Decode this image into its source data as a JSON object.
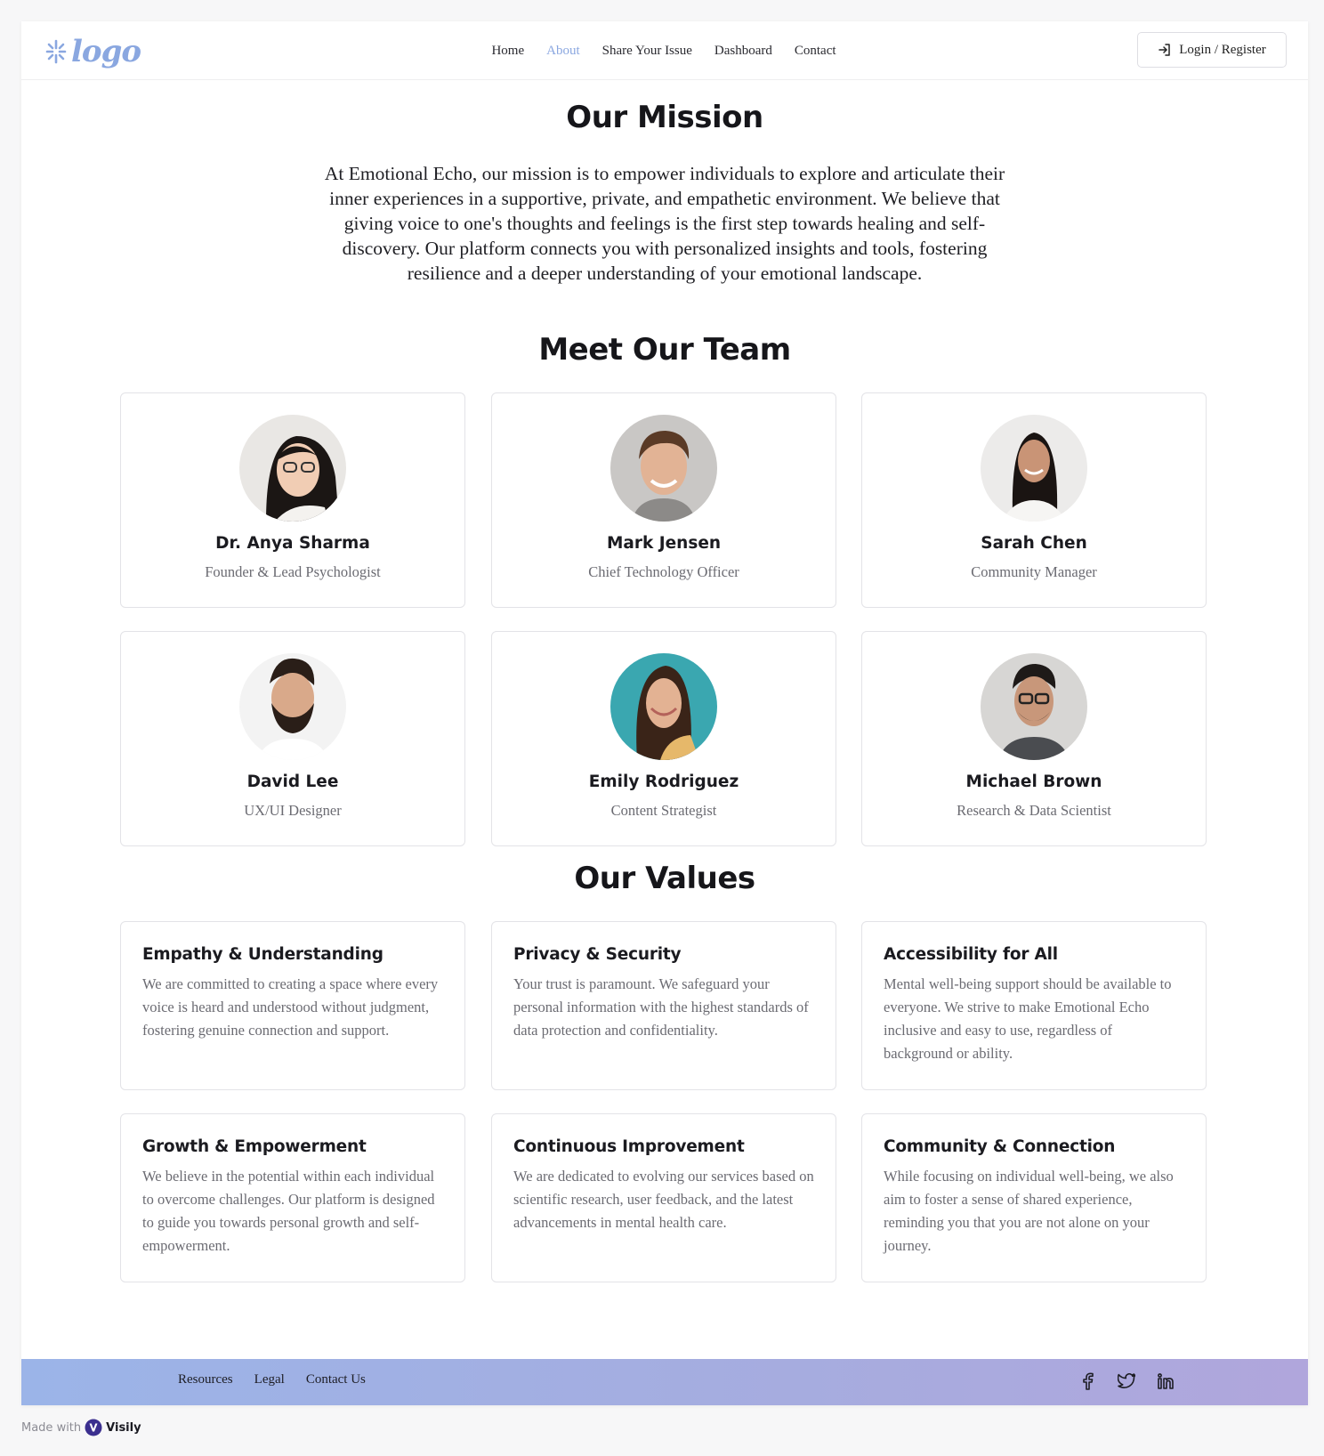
{
  "brand": {
    "logo_text": "logo",
    "accent_color": "#8aa7e0"
  },
  "nav": {
    "items": [
      "Home",
      "About",
      "Share Your Issue",
      "Dashboard",
      "Contact"
    ],
    "active": "About"
  },
  "login": {
    "label": "Login / Register",
    "icon": "login-icon"
  },
  "mission": {
    "title": "Our Mission",
    "text": "At Emotional Echo, our mission is to empower individuals to explore and articulate their inner experiences in a supportive, private, and empathetic environment. We believe that giving voice to one's thoughts and feelings is the first step towards healing and self-discovery. Our platform connects you with personalized insights and tools, fostering resilience and a deeper understanding of your emotional landscape."
  },
  "team": {
    "title": "Meet Our Team",
    "members": [
      {
        "name": "Dr. Anya Sharma",
        "role": "Founder & Lead Psychologist"
      },
      {
        "name": "Mark Jensen",
        "role": "Chief Technology Officer"
      },
      {
        "name": "Sarah Chen",
        "role": "Community Manager"
      },
      {
        "name": "David Lee",
        "role": "UX/UI Designer"
      },
      {
        "name": "Emily Rodriguez",
        "role": "Content Strategist"
      },
      {
        "name": "Michael Brown",
        "role": "Research & Data Scientist"
      }
    ]
  },
  "values": {
    "title": "Our Values",
    "items": [
      {
        "title": "Empathy & Understanding",
        "text": "We are committed to creating a space where every voice is heard and understood without judgment, fostering genuine connection and support."
      },
      {
        "title": "Privacy & Security",
        "text": "Your trust is paramount. We safeguard your personal information with the highest standards of data protection and confidentiality."
      },
      {
        "title": "Accessibility for All",
        "text": "Mental well-being support should be available to everyone. We strive to make Emotional Echo inclusive and easy to use, regardless of background or ability."
      },
      {
        "title": "Growth & Empowerment",
        "text": "We believe in the potential within each individual to overcome challenges. Our platform is designed to guide you towards personal growth and self-empowerment."
      },
      {
        "title": "Continuous Improvement",
        "text": "We are dedicated to evolving our services based on scientific research, user feedback, and the latest advancements in mental health care."
      },
      {
        "title": "Community & Connection",
        "text": "While focusing on individual well-being, we also aim to foster a sense of shared experience, reminding you that you are not alone on your journey."
      }
    ]
  },
  "footer": {
    "links": [
      "Resources",
      "Legal",
      "Contact Us"
    ],
    "social_icons": [
      "facebook-icon",
      "twitter-icon",
      "linkedin-icon"
    ],
    "gradient_start": "#9bb4e8",
    "gradient_end": "#b0a6dc"
  },
  "made_with": {
    "prefix": "Made with",
    "brand": "Visily"
  }
}
